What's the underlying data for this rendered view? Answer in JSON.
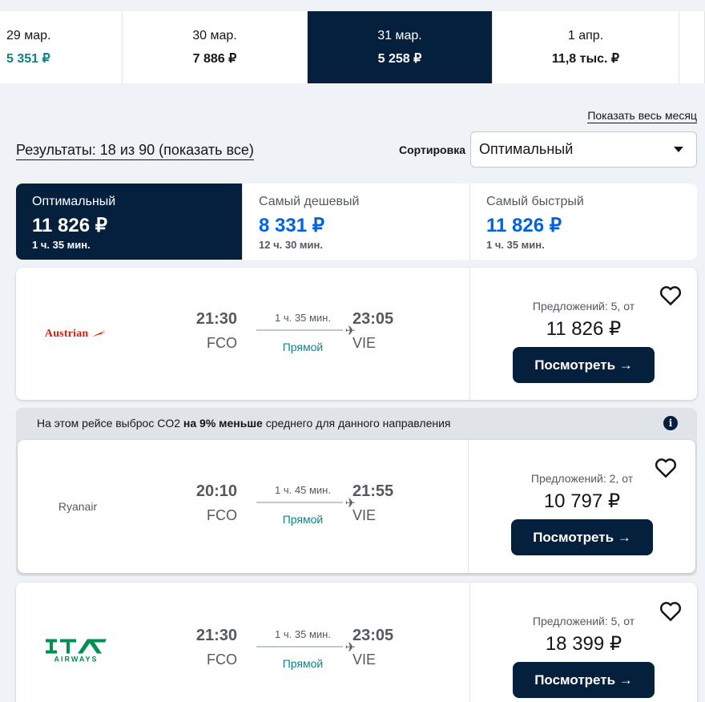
{
  "dates": [
    {
      "date": "29 мар.",
      "price": "5 351 ₽"
    },
    {
      "date": "30 мар.",
      "price": "7 886 ₽"
    },
    {
      "date": "31 мар.",
      "price": "5 258 ₽"
    },
    {
      "date": "1 апр.",
      "price": "11,8 тыс. ₽"
    }
  ],
  "show_month": "Показать весь месяц",
  "results": "Результаты: 18 из 90 (показать все)",
  "sort": {
    "label": "Сортировка",
    "value": "Оптимальный"
  },
  "tabs": [
    {
      "title": "Оптимальный",
      "price": "11 826 ₽",
      "duration": "1 ч. 35 мин."
    },
    {
      "title": "Самый дешевый",
      "price": "8 331 ₽",
      "duration": "12 ч. 30 мин."
    },
    {
      "title": "Самый быстрый",
      "price": "11 826 ₽",
      "duration": "1 ч. 35 мин."
    }
  ],
  "eco_banner": {
    "prefix": "На этом рейсе выброс CO2 ",
    "bold": "на 9% меньше",
    "suffix": " среднего для данного направления"
  },
  "flights": [
    {
      "airline": "Austrian",
      "dep_time": "21:30",
      "dep_airport": "FCO",
      "duration": "1 ч. 35 мин.",
      "stops": "Прямой",
      "arr_time": "23:05",
      "arr_airport": "VIE",
      "offers": "Предложений: 5, от",
      "price": "11 826 ₽",
      "button": "Посмотреть →"
    },
    {
      "airline": "Ryanair",
      "dep_time": "20:10",
      "dep_airport": "FCO",
      "duration": "1 ч. 45 мин.",
      "stops": "Прямой",
      "arr_time": "21:55",
      "arr_airport": "VIE",
      "offers": "Предложений: 2, от",
      "price": "10 797 ₽",
      "button": "Посмотреть →"
    },
    {
      "airline": "ITA",
      "airline_sub": "AIRWAYS",
      "dep_time": "21:30",
      "dep_airport": "FCO",
      "duration": "1 ч. 35 мин.",
      "stops": "Прямой",
      "arr_time": "23:05",
      "arr_airport": "VIE",
      "offers": "Предложений: 5, от",
      "price": "18 399 ₽",
      "button": "Посмотреть →"
    }
  ],
  "colors": {
    "navy": "#05203c",
    "teal": "#0c838a",
    "blue": "#0062e3",
    "austrian_red": "#d81e05",
    "ita_green": "#008f53"
  }
}
